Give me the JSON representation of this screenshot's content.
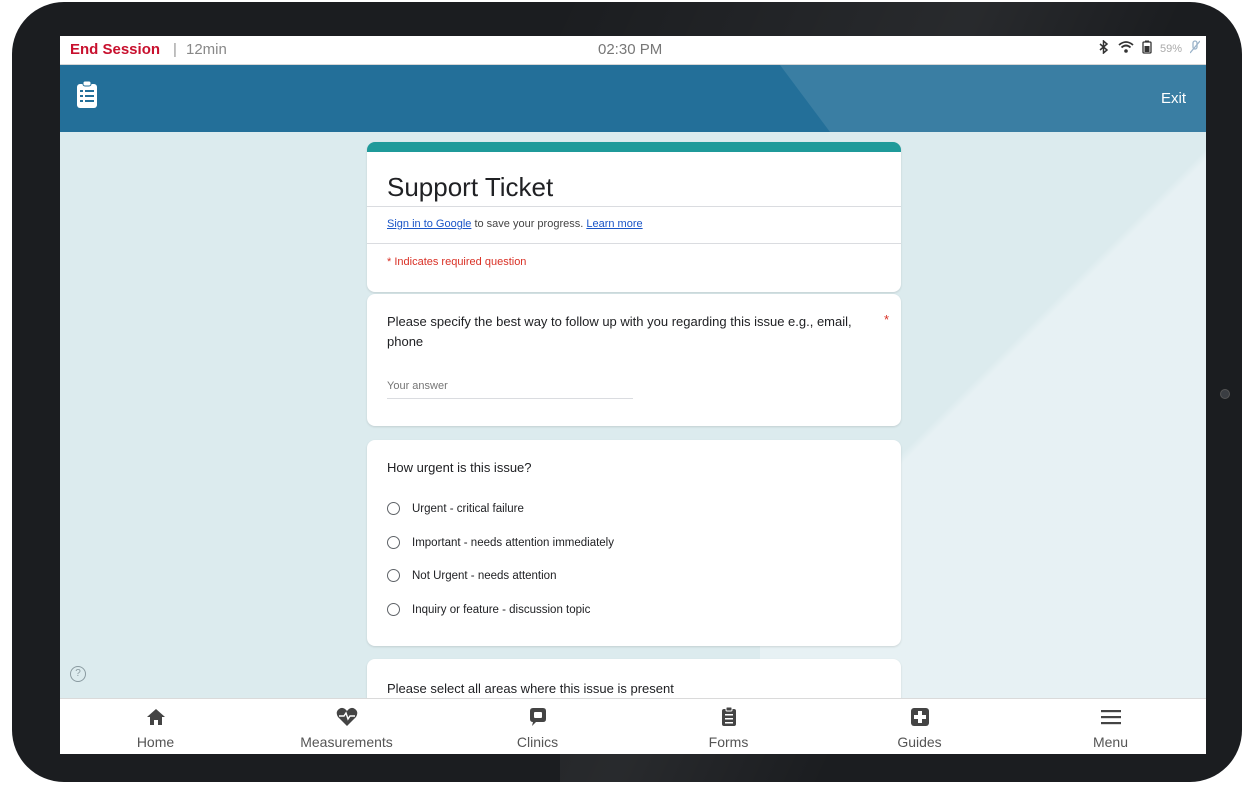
{
  "statusbar": {
    "end_session": "End Session",
    "separator": "|",
    "session_time": "12min",
    "clock": "02:30 PM",
    "battery": "59%",
    "icons": [
      "bluetooth-icon",
      "wifi-icon",
      "battery-icon",
      "mic-off-icon"
    ]
  },
  "appbar": {
    "icon": "clipboard-list-icon",
    "exit_label": "Exit"
  },
  "form": {
    "title": "Support Ticket",
    "sign_in_link": "Sign in to Google",
    "sign_in_text": " to save your progress. ",
    "learn_more": "Learn more",
    "required_note": "* Indicates required question",
    "accent_color": "#1f9a9a",
    "questions": [
      {
        "text": "Please specify the best way to follow up with you regarding this issue e.g., email, phone",
        "required": "*",
        "placeholder": "Your answer"
      },
      {
        "text": "How urgent is this issue?",
        "options": [
          "Urgent - critical failure",
          "Important - needs attention immediately",
          "Not Urgent - needs attention",
          "Inquiry or feature - discussion topic"
        ]
      },
      {
        "text": "Please select all areas where this issue is present"
      }
    ]
  },
  "help": {
    "icon": "help-circle-icon",
    "glyph": "?"
  },
  "nav": {
    "items": [
      {
        "label": "Home",
        "icon": "home-icon"
      },
      {
        "label": "Measurements",
        "icon": "heart-pulse-icon"
      },
      {
        "label": "Clinics",
        "icon": "chat-bubble-icon"
      },
      {
        "label": "Forms",
        "icon": "clipboard-icon"
      },
      {
        "label": "Guides",
        "icon": "medical-cross-icon"
      },
      {
        "label": "Menu",
        "icon": "hamburger-menu-icon"
      }
    ]
  }
}
